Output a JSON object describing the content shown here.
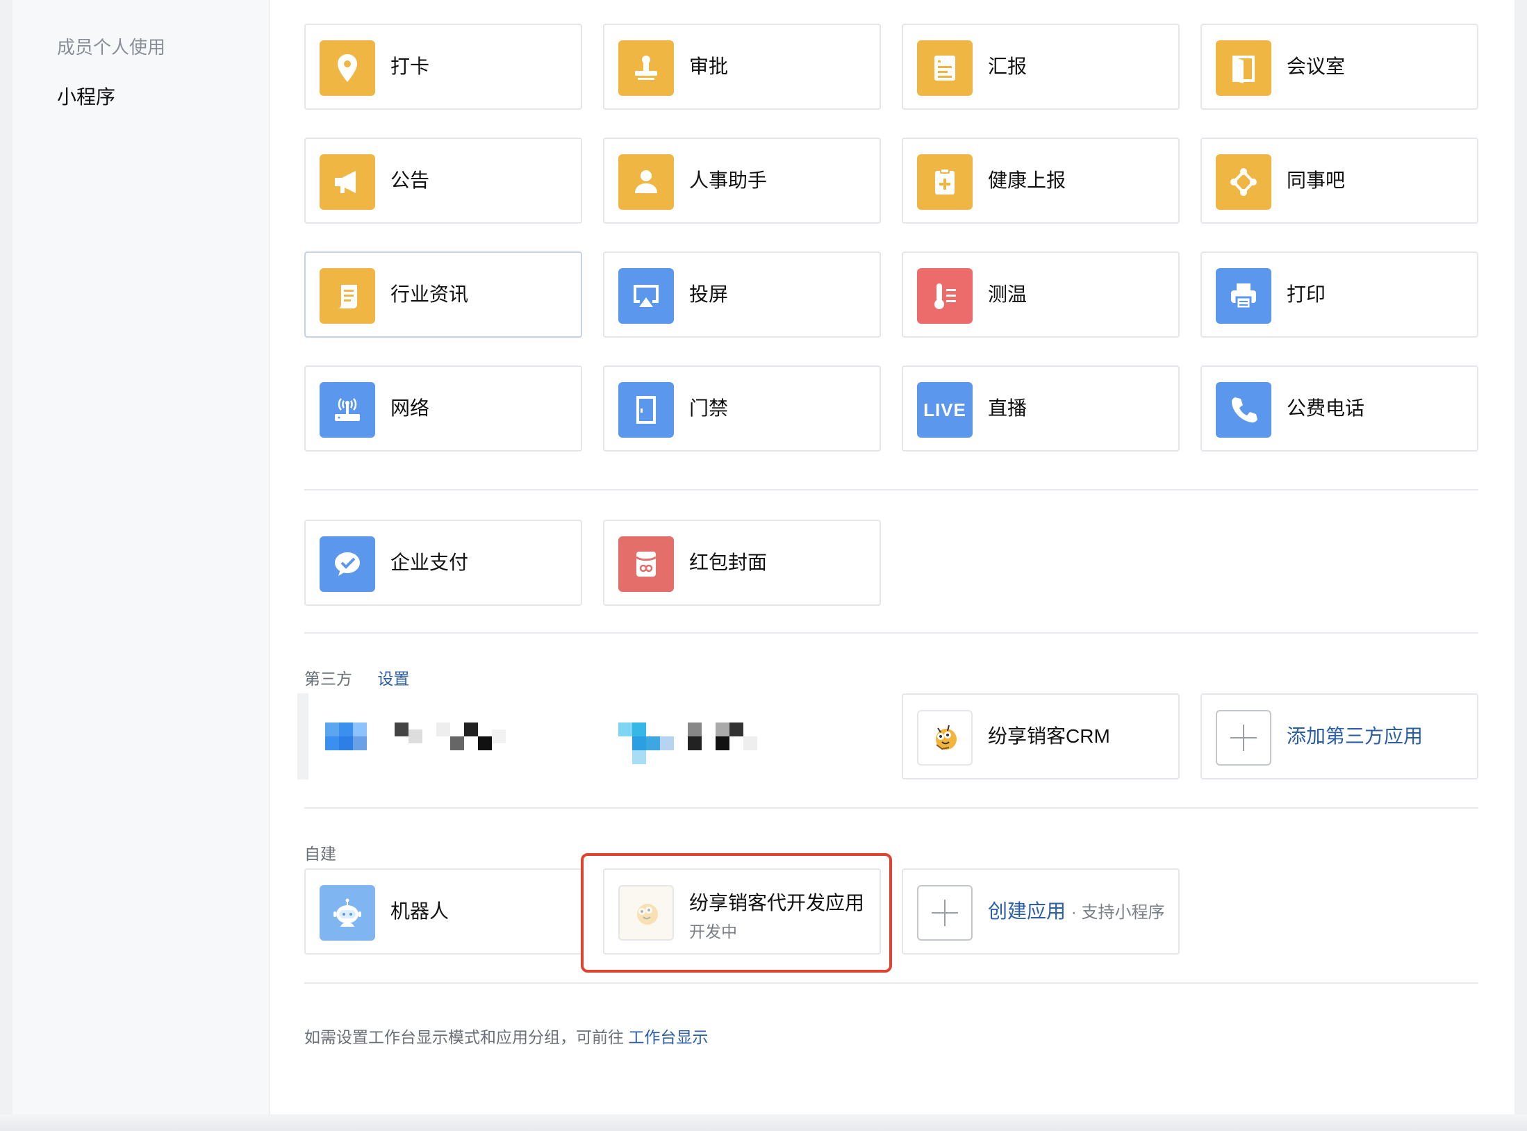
{
  "sidebar": {
    "items": [
      {
        "label": "成员个人使用"
      },
      {
        "label": "小程序"
      }
    ]
  },
  "apps": {
    "row1": [
      {
        "label": "打卡",
        "icon": "location-pin-icon",
        "color": "#f0b643"
      },
      {
        "label": "审批",
        "icon": "stamp-icon",
        "color": "#f0b643"
      },
      {
        "label": "汇报",
        "icon": "document-list-icon",
        "color": "#f0b643"
      },
      {
        "label": "会议室",
        "icon": "door-icon",
        "color": "#f0b643"
      }
    ],
    "row2": [
      {
        "label": "公告",
        "icon": "megaphone-icon",
        "color": "#f0b643"
      },
      {
        "label": "人事助手",
        "icon": "person-icon",
        "color": "#f0b643"
      },
      {
        "label": "健康上报",
        "icon": "medical-clipboard-icon",
        "color": "#f0b643"
      },
      {
        "label": "同事吧",
        "icon": "network-nodes-icon",
        "color": "#f0b643"
      }
    ],
    "row3": [
      {
        "label": "行业资讯",
        "icon": "scroll-icon",
        "color": "#f0b643"
      },
      {
        "label": "投屏",
        "icon": "screen-cast-icon",
        "color": "#5b97ec"
      },
      {
        "label": "测温",
        "icon": "thermometer-icon",
        "color": "#ec6c6c"
      },
      {
        "label": "打印",
        "icon": "printer-icon",
        "color": "#5b97ec"
      }
    ],
    "row4": [
      {
        "label": "网络",
        "icon": "router-icon",
        "color": "#5b97ec"
      },
      {
        "label": "门禁",
        "icon": "access-door-icon",
        "color": "#5b97ec"
      },
      {
        "label": "直播",
        "icon": "live-icon",
        "icon_text": "LIVE",
        "color": "#5b97ec"
      },
      {
        "label": "公费电话",
        "icon": "phone-icon",
        "color": "#5b97ec"
      }
    ]
  },
  "payments": [
    {
      "label": "企业支付",
      "icon": "wecom-pay-icon",
      "color": "#5b97ec"
    },
    {
      "label": "红包封面",
      "icon": "red-packet-icon",
      "color": "#e46e6a"
    }
  ],
  "third_party": {
    "title": "第三方",
    "settings_link": "设置",
    "apps": [
      {
        "label": "纷享销客CRM",
        "icon": "bee-mascot-icon"
      }
    ],
    "add_label": "添加第三方应用"
  },
  "self_built": {
    "title": "自建",
    "apps": [
      {
        "label": "机器人",
        "icon": "robot-icon"
      },
      {
        "label": "纷享销客代开发应用",
        "status": "开发中",
        "icon": "bee-mascot-icon"
      }
    ],
    "create_label": "创建应用",
    "create_hint": "· 支持小程序"
  },
  "footer": {
    "note": "如需设置工作台显示模式和应用分组，可前往",
    "link": "工作台显示"
  }
}
